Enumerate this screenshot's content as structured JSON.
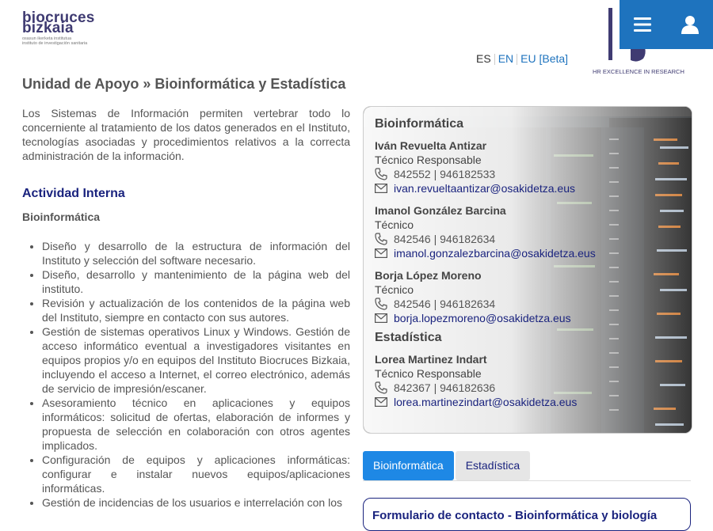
{
  "header": {
    "logo_main_line1": "biocruces",
    "logo_main_line2": "bizkaia",
    "logo_sub_line1": "osasun ikerketa institutua",
    "logo_sub_line2": "instituto de investigación sanitaria",
    "hr_badge": "HR EXCELLENCE IN RESEARCH",
    "menu_icon": "hamburger-menu-icon",
    "user_icon": "user-icon",
    "accent_color": "#1e73be"
  },
  "languages": [
    {
      "label": "ES"
    },
    {
      "label": "EN"
    },
    {
      "label": "EU [Beta]"
    }
  ],
  "page": {
    "title": "Unidad de Apoyo » Bioinformática y Estadística",
    "intro": "Los Sistemas de Información permiten vertebrar todo lo concerniente al tratamiento de los datos generados en el Instituto, tecnologías asociadas y procedimientos relativos a la correcta administración de la información.",
    "section_title": "Actividad Interna",
    "sub_title": "Bioinformática",
    "tasks": [
      "Diseño y desarrollo de la estructura de información del Instituto y selección del software necesario.",
      "Diseño, desarrollo y mantenimiento de la página web del instituto.",
      "Revisión y actualización de los contenidos de la página web del Instituto, siempre en contacto con sus autores.",
      "Gestión de sistemas operativos Linux y Windows. Gestión de acceso informático eventual a investigadores visitantes en equipos propios y/o en equipos del Instituto Biocruces Bizkaia, incluyendo el acceso a Internet, el correo electrónico, además de servicio de impresión/escaner.",
      "Asesoramiento técnico en aplicaciones y equipos informáticos: solicitud de ofertas, elaboración de informes y propuesta de selección en colaboración con otros agentes implicados.",
      "Configuración de equipos y aplicaciones informáticas: configurar e instalar nuevos equipos/aplicaciones informáticas.",
      "Gestión de incidencias de los usuarios e interrelación con los"
    ]
  },
  "contacts": {
    "group1": "Bioinformática",
    "group2": "Estadística",
    "people": [
      {
        "name": "Iván Revuelta Antizar",
        "role": "Técnico Responsable",
        "phone": "842552 | 946182533",
        "email": "ivan.revueltaantizar@osakidetza.eus"
      },
      {
        "name": "Imanol González Barcina",
        "role": "Técnico",
        "phone": "842546 | 946182634",
        "email": "imanol.gonzalezbarcina@osakidetza.eus"
      },
      {
        "name": "Borja López Moreno",
        "role": "Técnico",
        "phone": "842546 | 946182634",
        "email": "borja.lopezmoreno@osakidetza.eus"
      },
      {
        "name": "Lorea Martinez Indart",
        "role": "Técnico Responsable",
        "phone": "842367 | 946182636",
        "email": "lorea.martinezindart@osakidetza.eus"
      }
    ],
    "phone_icon": "phone-icon",
    "email_icon": "envelope-icon"
  },
  "tabs": [
    {
      "label": "Bioinformática",
      "active": true
    },
    {
      "label": "Estadística",
      "active": false
    }
  ],
  "form": {
    "title": "Formulario de contacto - Bioinformática y biología"
  }
}
